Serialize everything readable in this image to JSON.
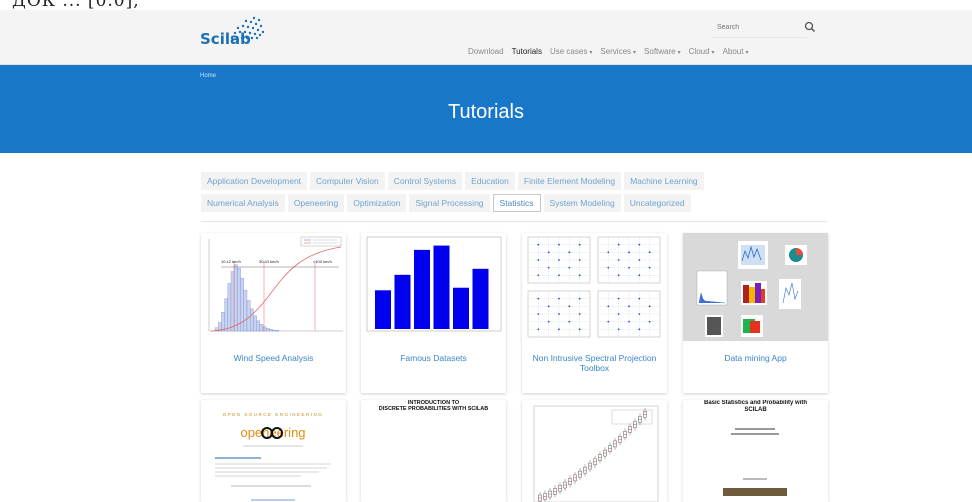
{
  "top_fragment": "ДОК ... [0.0],",
  "header": {
    "logo_text": "Scilab",
    "search_placeholder": "Search"
  },
  "nav": [
    {
      "label": "Download",
      "has_caret": false
    },
    {
      "label": "Tutorials",
      "has_caret": false,
      "active": true
    },
    {
      "label": "Use cases",
      "has_caret": true
    },
    {
      "label": "Services",
      "has_caret": true
    },
    {
      "label": "Software",
      "has_caret": true
    },
    {
      "label": "Cloud",
      "has_caret": true
    },
    {
      "label": "About",
      "has_caret": true
    }
  ],
  "hero": {
    "breadcrumb": "Home",
    "title": "Tutorials"
  },
  "categories_row1": [
    "Application Development",
    "Computer Vision",
    "Control Systems",
    "Education",
    "Finite Element Modeling",
    "Machine Learning"
  ],
  "categories_row2": [
    "Numerical Analysis",
    "Openeering",
    "Optimization",
    "Signal Processing",
    "Statistics",
    "System Modeling",
    "Uncategorized"
  ],
  "active_category": "Statistics",
  "cards_row1": [
    {
      "title": "Wind Speed Analysis",
      "thumb": "histogram-chart"
    },
    {
      "title": "Famous Datasets",
      "thumb": "bar-chart"
    },
    {
      "title": "Non Intrusive Spectral Projection Toolbox",
      "thumb": "grid-plots"
    },
    {
      "title": "Data mining App",
      "thumb": "app-screenshot"
    }
  ],
  "cards_row2": [
    {
      "thumb": "openeering-doc",
      "doc_header": "OPEN SOURCE ENGINEERING",
      "doc_logo": "openeering"
    },
    {
      "thumb": "discrete-prob-doc",
      "doc_title": "INTRODUCTION TO\nDISCRETE PROBABILITIES WITH SCILAB"
    },
    {
      "thumb": "boxplot-chart"
    },
    {
      "thumb": "basic-stats-doc",
      "doc_title": "Basic Statistics and Probability with SCILAB"
    }
  ],
  "wind_chart": {
    "labels": [
      "10.12 km/h",
      "30.43 km/h",
      "<100 km/h"
    ]
  },
  "bar_chart": {
    "values": [
      45,
      63,
      92,
      97,
      48,
      70
    ],
    "ylim": [
      0,
      100
    ]
  },
  "colors": {
    "brand_blue": "#1877c9",
    "link_blue": "#3a86c8",
    "bar_blue": "#0000ee"
  }
}
